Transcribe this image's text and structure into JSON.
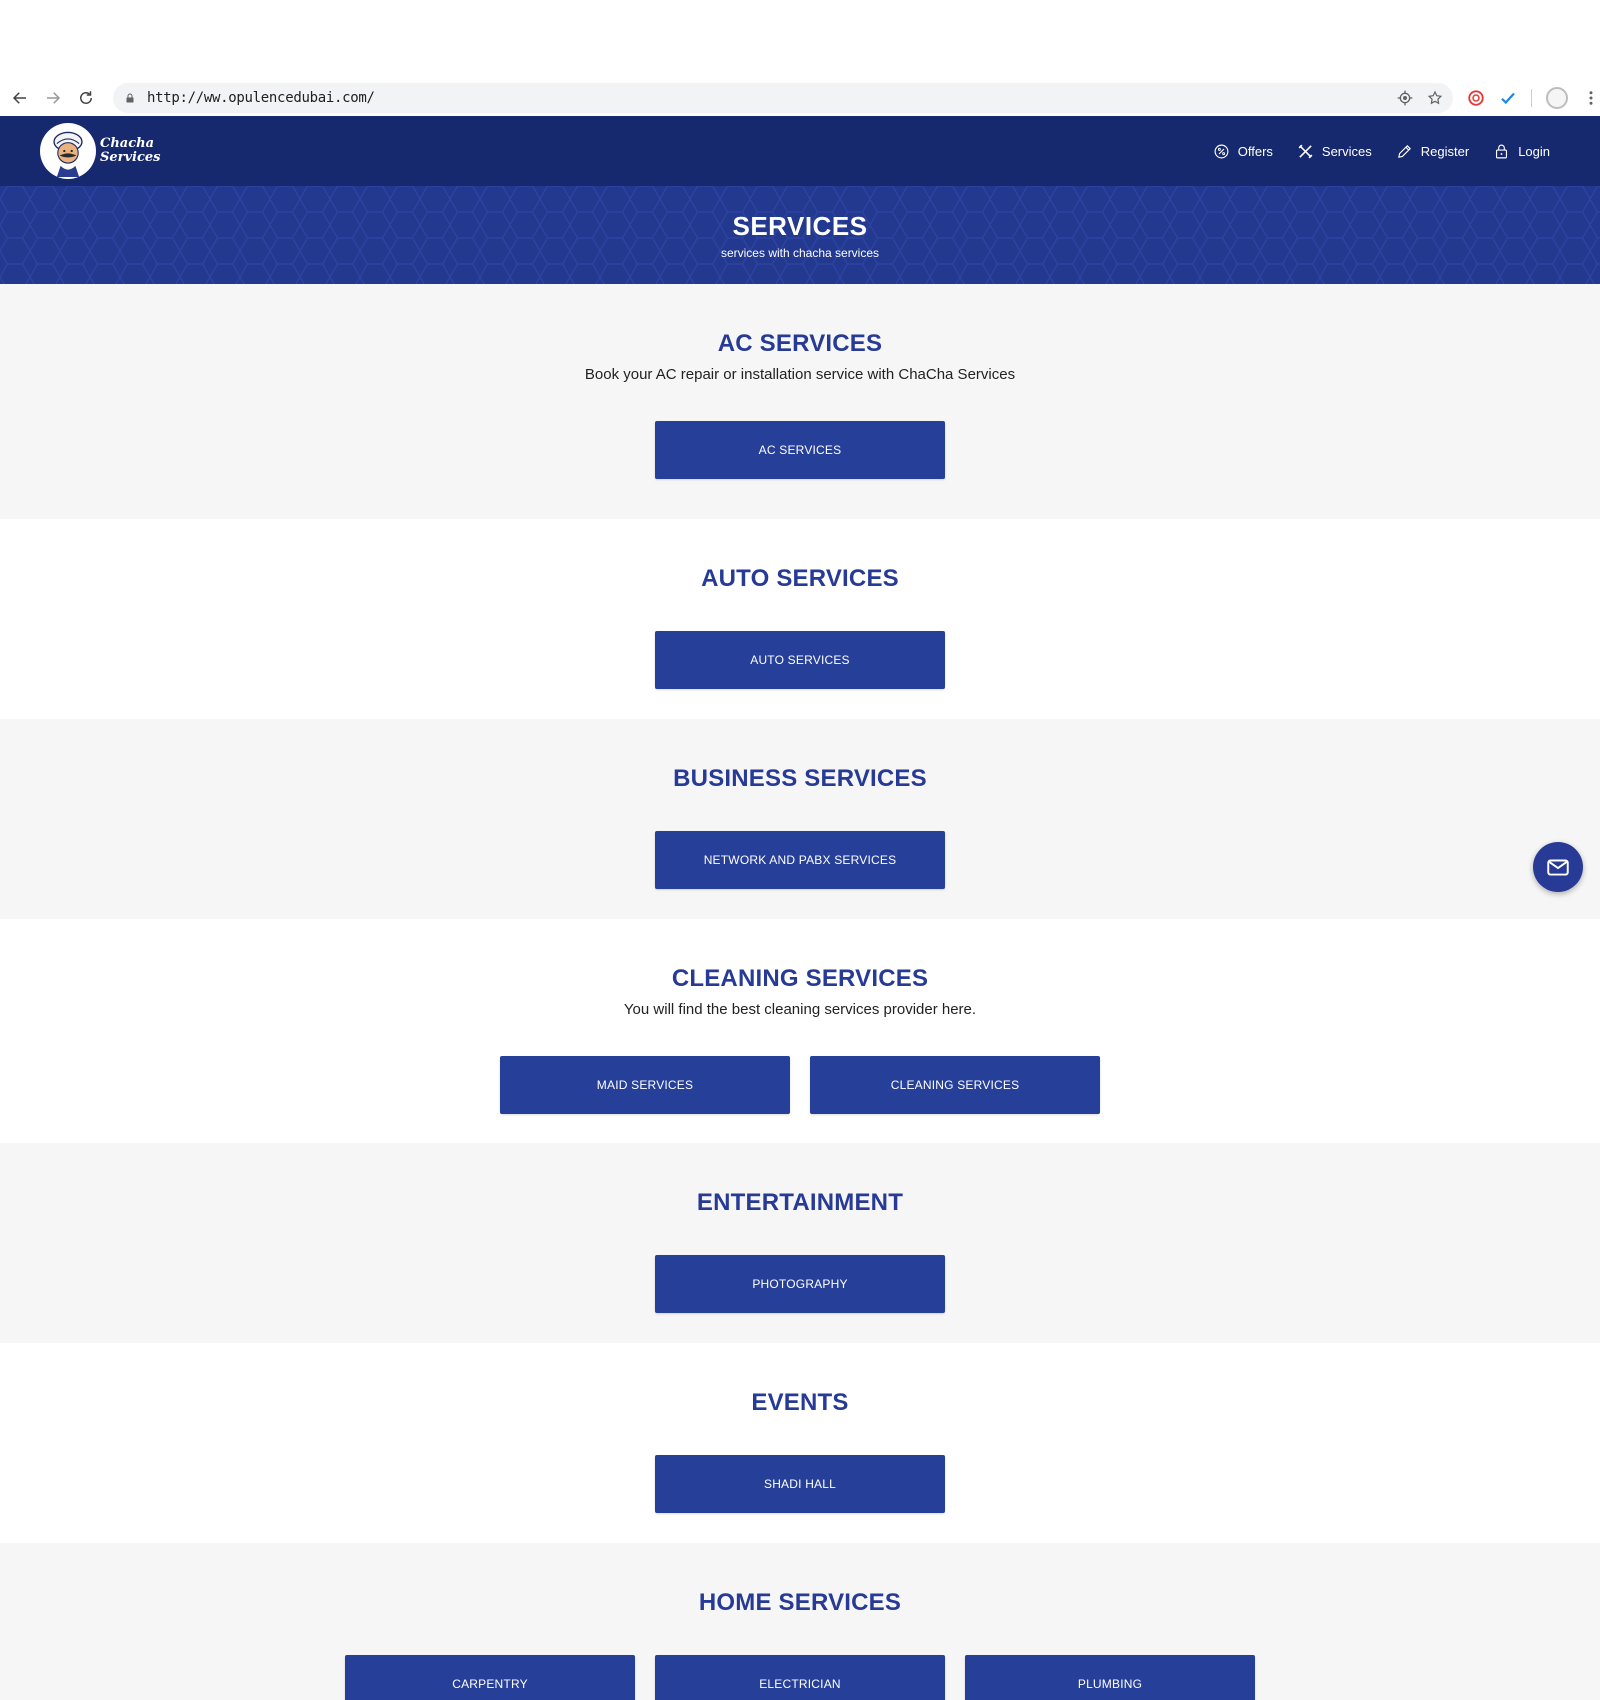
{
  "browser": {
    "url": "http://ww.opulencedubai.com/"
  },
  "header": {
    "logo_line1": "Chacha",
    "logo_line2": "Services",
    "menu": [
      {
        "label": "Offers",
        "icon": "percent-badge-icon"
      },
      {
        "label": "Services",
        "icon": "tools-icon"
      },
      {
        "label": "Register",
        "icon": "pencil-icon"
      },
      {
        "label": "Login",
        "icon": "lock-icon"
      }
    ]
  },
  "hero": {
    "title": "SERVICES",
    "subtitle": "services with chacha services"
  },
  "sections": [
    {
      "title": "AC SERVICES",
      "description": "Book your AC repair or installation service with ChaCha Services",
      "buttons": [
        "AC SERVICES"
      ]
    },
    {
      "title": "AUTO SERVICES",
      "description": "",
      "buttons": [
        "AUTO SERVICES"
      ]
    },
    {
      "title": "BUSINESS SERVICES",
      "description": "",
      "buttons": [
        "NETWORK AND PABX SERVICES"
      ]
    },
    {
      "title": "CLEANING SERVICES",
      "description": "You will find the best cleaning services provider here.",
      "buttons": [
        "MAID SERVICES",
        "CLEANING SERVICES"
      ]
    },
    {
      "title": "ENTERTAINMENT",
      "description": "",
      "buttons": [
        "PHOTOGRAPHY"
      ]
    },
    {
      "title": "EVENTS",
      "description": "",
      "buttons": [
        "SHADI HALL"
      ]
    },
    {
      "title": "HOME SERVICES",
      "description": "",
      "buttons": [
        "CARPENTRY",
        "ELECTRICIAN",
        "PLUMBING"
      ]
    }
  ],
  "colors": {
    "header_bg": "#17296e",
    "hero_bg": "#23388f",
    "accent": "#263a96",
    "button_bg": "#263f98"
  }
}
